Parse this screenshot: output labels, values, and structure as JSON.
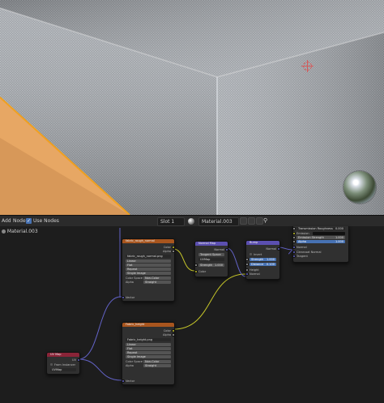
{
  "header": {
    "add_menu": "Add",
    "node_menu": "Node",
    "use_nodes_label": "Use Nodes",
    "use_nodes_checked": true,
    "slot_value": "Slot 1",
    "material_name": "Material.003"
  },
  "breadcrumb": "Material.003",
  "colors": {
    "viewport_floor": "#e7a764",
    "selection_outline": "#f0a020",
    "texture_node_header": "#a8551e",
    "vector_node_header": "#5b4fb0",
    "input_node_header": "#8a2438",
    "socket_color": "#c7c729",
    "socket_vector": "#6363c7",
    "socket_float": "#a1a1a1",
    "highlight_field": "#4772b3"
  },
  "nodes": {
    "image_texture_1": {
      "title": "fabric_rough_normal",
      "out_color": "Color",
      "out_alpha": "Alpha",
      "image_name": "fabric_rough_normal.png",
      "interpolation": "Linear",
      "projection": "Flat",
      "extension": "Repeat",
      "source": "Single Image",
      "color_space_label": "Color Space",
      "color_space_value": "Non-Color",
      "alpha_label": "Alpha",
      "alpha_value": "Straight",
      "in_vector": "Vector"
    },
    "normal_map": {
      "title": "Normal Map",
      "out_normal": "Normal",
      "space": "Tangent Space",
      "uv": "UVMap",
      "strength": "Strength",
      "strength_value": "1.000",
      "in_color": "Color"
    },
    "bump": {
      "title": "Bump",
      "out_normal": "Normal",
      "invert": "Invert",
      "strength": "Strength",
      "strength_value": "1.000",
      "distance": "Distance",
      "distance_value": "0.100",
      "in_height": "Height",
      "in_normal": "Normal"
    },
    "bsdf": {
      "row1": "Transmission Roughness",
      "row1_value": "0.000",
      "row2": "Emission",
      "row3": "Emission Strength",
      "row3_value": "1.000",
      "row4": "Alpha",
      "row4_value": "1.000",
      "row5": "Normal",
      "row6": "Clearcoat Normal",
      "row7": "Tangent"
    },
    "image_texture_2": {
      "title": "Fabric_height",
      "out_color": "Color",
      "out_alpha": "Alpha",
      "image_name": "Fabric_height.png",
      "interpolation": "Linear",
      "projection": "Flat",
      "extension": "Repeat",
      "source": "Single Image",
      "color_space_label": "Color Space",
      "color_space_value": "Non-Color",
      "alpha_label": "Alpha",
      "alpha_value": "Straight",
      "in_vector": "Vector"
    },
    "uv_map": {
      "title": "UV Map",
      "out_uv": "UV",
      "from_instancer": "From Instancer",
      "uv_value": "UVMap"
    }
  }
}
